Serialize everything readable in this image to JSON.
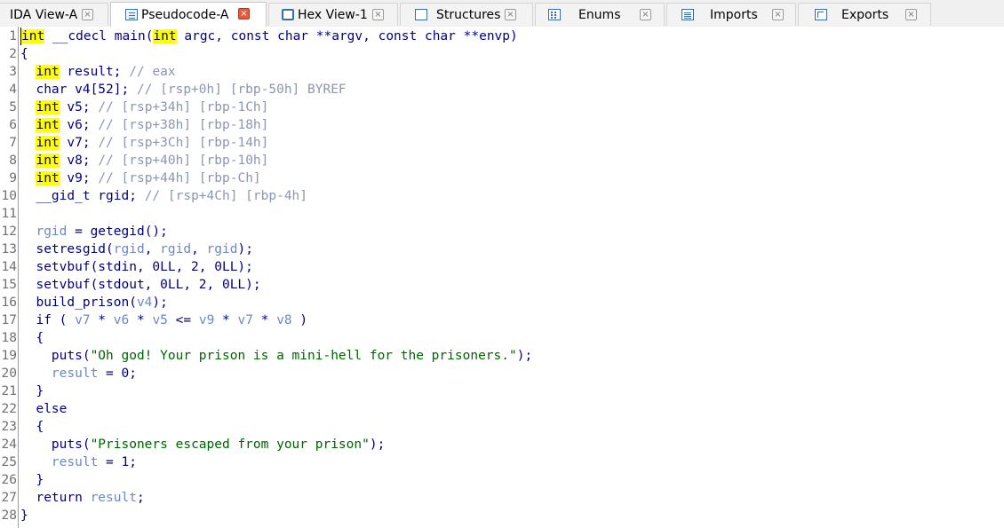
{
  "tabs": [
    {
      "label": "IDA View-A",
      "icon": "list-icon",
      "active": false
    },
    {
      "label": "Pseudocode-A",
      "icon": "pseudocode-icon",
      "active": true
    },
    {
      "label": "Hex View-1",
      "icon": "hex-icon",
      "active": false
    },
    {
      "label": "Structures",
      "icon": "structures-icon",
      "active": false
    },
    {
      "label": "Enums",
      "icon": "enums-icon",
      "active": false
    },
    {
      "label": "Imports",
      "icon": "imports-icon",
      "active": false
    },
    {
      "label": "Exports",
      "icon": "exports-icon",
      "active": false
    }
  ],
  "close_glyph": "×",
  "colors": {
    "keyword_highlight": "#ffff00",
    "comment": "#8b96b0",
    "variable": "#6f86c9",
    "string": "#006400",
    "code": "#000080",
    "active_close": "#e8593b"
  },
  "code_lines": [
    {
      "n": "1",
      "parts": [
        [
          "hl",
          "int"
        ],
        [
          "kw",
          " __cdecl main("
        ],
        [
          "hl",
          "int"
        ],
        [
          "kw",
          " argc, const char **argv, const char **envp)"
        ]
      ]
    },
    {
      "n": "2",
      "parts": [
        [
          "kw",
          "{"
        ]
      ]
    },
    {
      "n": "3",
      "parts": [
        [
          "kw",
          "  "
        ],
        [
          "hl",
          "int"
        ],
        [
          "kw",
          " result; "
        ],
        [
          "cm",
          "// eax"
        ]
      ]
    },
    {
      "n": "4",
      "parts": [
        [
          "kw",
          "  char v4[52]; "
        ],
        [
          "cm",
          "// [rsp+0h] [rbp-50h] BYREF"
        ]
      ]
    },
    {
      "n": "5",
      "parts": [
        [
          "kw",
          "  "
        ],
        [
          "hl",
          "int"
        ],
        [
          "kw",
          " v5; "
        ],
        [
          "cm",
          "// [rsp+34h] [rbp-1Ch]"
        ]
      ]
    },
    {
      "n": "6",
      "parts": [
        [
          "kw",
          "  "
        ],
        [
          "hl",
          "int"
        ],
        [
          "kw",
          " v6; "
        ],
        [
          "cm",
          "// [rsp+38h] [rbp-18h]"
        ]
      ]
    },
    {
      "n": "7",
      "parts": [
        [
          "kw",
          "  "
        ],
        [
          "hl",
          "int"
        ],
        [
          "kw",
          " v7; "
        ],
        [
          "cm",
          "// [rsp+3Ch] [rbp-14h]"
        ]
      ]
    },
    {
      "n": "8",
      "parts": [
        [
          "kw",
          "  "
        ],
        [
          "hl",
          "int"
        ],
        [
          "kw",
          " v8; "
        ],
        [
          "cm",
          "// [rsp+40h] [rbp-10h]"
        ]
      ]
    },
    {
      "n": "9",
      "parts": [
        [
          "kw",
          "  "
        ],
        [
          "hl",
          "int"
        ],
        [
          "kw",
          " v9; "
        ],
        [
          "cm",
          "// [rsp+44h] [rbp-Ch]"
        ]
      ]
    },
    {
      "n": "10",
      "parts": [
        [
          "kw",
          "  __gid_t rgid; "
        ],
        [
          "cm",
          "// [rsp+4Ch] [rbp-4h]"
        ]
      ]
    },
    {
      "n": "11",
      "parts": []
    },
    {
      "n": "12",
      "parts": [
        [
          "kw",
          "  "
        ],
        [
          "vr",
          "rgid"
        ],
        [
          "kw",
          " = getegid();"
        ]
      ]
    },
    {
      "n": "13",
      "parts": [
        [
          "kw",
          "  setresgid("
        ],
        [
          "vr",
          "rgid"
        ],
        [
          "kw",
          ", "
        ],
        [
          "vr",
          "rgid"
        ],
        [
          "kw",
          ", "
        ],
        [
          "vr",
          "rgid"
        ],
        [
          "kw",
          ");"
        ]
      ]
    },
    {
      "n": "14",
      "parts": [
        [
          "kw",
          "  setvbuf(stdin, 0LL, 2, 0LL);"
        ]
      ]
    },
    {
      "n": "15",
      "parts": [
        [
          "kw",
          "  setvbuf(stdout, 0LL, 2, 0LL);"
        ]
      ]
    },
    {
      "n": "16",
      "parts": [
        [
          "kw",
          "  build_prison("
        ],
        [
          "vr",
          "v4"
        ],
        [
          "kw",
          ");"
        ]
      ]
    },
    {
      "n": "17",
      "parts": [
        [
          "kw",
          "  if ( "
        ],
        [
          "vr",
          "v7"
        ],
        [
          "kw",
          " * "
        ],
        [
          "vr",
          "v6"
        ],
        [
          "kw",
          " * "
        ],
        [
          "vr",
          "v5"
        ],
        [
          "kw",
          " <= "
        ],
        [
          "vr",
          "v9"
        ],
        [
          "kw",
          " * "
        ],
        [
          "vr",
          "v7"
        ],
        [
          "kw",
          " * "
        ],
        [
          "vr",
          "v8"
        ],
        [
          "kw",
          " )"
        ]
      ]
    },
    {
      "n": "18",
      "parts": [
        [
          "kw",
          "  {"
        ]
      ]
    },
    {
      "n": "19",
      "parts": [
        [
          "kw",
          "    puts("
        ],
        [
          "st",
          "\"Oh god! Your prison is a mini-hell for the prisoners.\""
        ],
        [
          "kw",
          ");"
        ]
      ]
    },
    {
      "n": "20",
      "parts": [
        [
          "kw",
          "    "
        ],
        [
          "vr",
          "result"
        ],
        [
          "kw",
          " = 0;"
        ]
      ]
    },
    {
      "n": "21",
      "parts": [
        [
          "kw",
          "  }"
        ]
      ]
    },
    {
      "n": "22",
      "parts": [
        [
          "kw",
          "  else"
        ]
      ]
    },
    {
      "n": "23",
      "parts": [
        [
          "kw",
          "  {"
        ]
      ]
    },
    {
      "n": "24",
      "parts": [
        [
          "kw",
          "    puts("
        ],
        [
          "st",
          "\"Prisoners escaped from your prison\""
        ],
        [
          "kw",
          ");"
        ]
      ]
    },
    {
      "n": "25",
      "parts": [
        [
          "kw",
          "    "
        ],
        [
          "vr",
          "result"
        ],
        [
          "kw",
          " = 1;"
        ]
      ]
    },
    {
      "n": "26",
      "parts": [
        [
          "kw",
          "  }"
        ]
      ]
    },
    {
      "n": "27",
      "parts": [
        [
          "kw",
          "  return "
        ],
        [
          "vr",
          "result"
        ],
        [
          "kw",
          ";"
        ]
      ]
    },
    {
      "n": "28",
      "parts": [
        [
          "kw",
          "}"
        ]
      ]
    }
  ]
}
